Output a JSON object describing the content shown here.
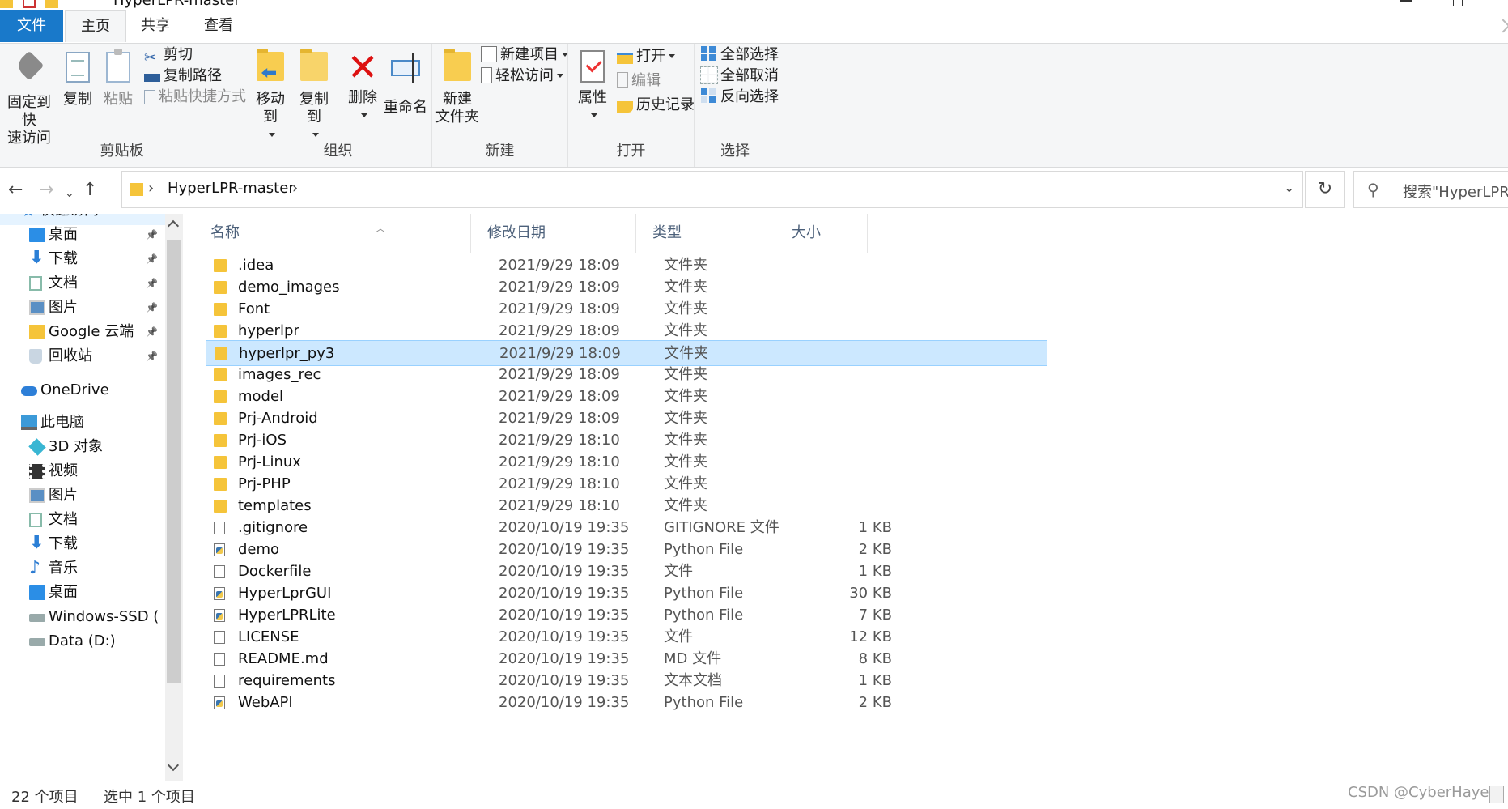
{
  "window": {
    "title": "HyperLPR-master"
  },
  "tabs": {
    "file": "文件",
    "home": "主页",
    "share": "共享",
    "view": "查看"
  },
  "ribbon": {
    "clipboard": {
      "pin": "固定到快速访问",
      "pin_line1": "固定到快",
      "pin_line2": "速访问",
      "copy": "复制",
      "paste": "粘贴",
      "cut": "剪切",
      "copy_path": "复制路径",
      "paste_shortcut": "粘贴快捷方式",
      "label": "剪贴板"
    },
    "organize": {
      "move_to": "移动到",
      "copy_to": "复制到",
      "delete": "删除",
      "rename": "重命名",
      "label": "组织"
    },
    "new": {
      "new_folder_line1": "新建",
      "new_folder_line2": "文件夹",
      "new_item": "新建项目",
      "easy_access": "轻松访问",
      "label": "新建"
    },
    "open": {
      "properties": "属性",
      "open": "打开",
      "edit": "编辑",
      "history": "历史记录",
      "label": "打开"
    },
    "select": {
      "select_all": "全部选择",
      "select_none": "全部取消",
      "invert": "反向选择",
      "label": "选择"
    }
  },
  "address": {
    "path": "HyperLPR-master",
    "search_placeholder": "搜索\"HyperLPR"
  },
  "sidebar": {
    "items": [
      {
        "label": "快速访问",
        "icon": "star-icon",
        "pinned": false
      },
      {
        "label": "桌面",
        "icon": "desktop-icon",
        "pinned": true
      },
      {
        "label": "下载",
        "icon": "download-icon",
        "pinned": true
      },
      {
        "label": "文档",
        "icon": "document-icon",
        "pinned": true
      },
      {
        "label": "图片",
        "icon": "picture-icon",
        "pinned": true
      },
      {
        "label": "Google 云端",
        "icon": "google-drive-folder-icon",
        "pinned": true
      },
      {
        "label": "回收站",
        "icon": "recycle-bin-icon",
        "pinned": true
      },
      {
        "label": "OneDrive",
        "icon": "cloud-icon",
        "pinned": false
      },
      {
        "label": "此电脑",
        "icon": "computer-icon",
        "pinned": false
      },
      {
        "label": "3D 对象",
        "icon": "cube-icon",
        "pinned": false
      },
      {
        "label": "视频",
        "icon": "video-icon",
        "pinned": false
      },
      {
        "label": "图片",
        "icon": "picture-icon",
        "pinned": false
      },
      {
        "label": "文档",
        "icon": "document-icon",
        "pinned": false
      },
      {
        "label": "下载",
        "icon": "download-icon",
        "pinned": false
      },
      {
        "label": "音乐",
        "icon": "music-icon",
        "pinned": false
      },
      {
        "label": "桌面",
        "icon": "desktop-icon",
        "pinned": false
      },
      {
        "label": "Windows-SSD (",
        "icon": "drive-icon",
        "pinned": false
      },
      {
        "label": "Data (D:)",
        "icon": "drive-icon",
        "pinned": false
      }
    ]
  },
  "columns": {
    "name": "名称",
    "date": "修改日期",
    "type": "类型",
    "size": "大小"
  },
  "files": [
    {
      "name": ".idea",
      "date": "2021/9/29 18:09",
      "type": "文件夹",
      "size": "",
      "kind": "folder"
    },
    {
      "name": "demo_images",
      "date": "2021/9/29 18:09",
      "type": "文件夹",
      "size": "",
      "kind": "folder"
    },
    {
      "name": "Font",
      "date": "2021/9/29 18:09",
      "type": "文件夹",
      "size": "",
      "kind": "folder"
    },
    {
      "name": "hyperlpr",
      "date": "2021/9/29 18:09",
      "type": "文件夹",
      "size": "",
      "kind": "folder"
    },
    {
      "name": "hyperlpr_py3",
      "date": "2021/9/29 18:09",
      "type": "文件夹",
      "size": "",
      "kind": "folder",
      "selected": true
    },
    {
      "name": "images_rec",
      "date": "2021/9/29 18:09",
      "type": "文件夹",
      "size": "",
      "kind": "folder"
    },
    {
      "name": "model",
      "date": "2021/9/29 18:09",
      "type": "文件夹",
      "size": "",
      "kind": "folder"
    },
    {
      "name": "Prj-Android",
      "date": "2021/9/29 18:09",
      "type": "文件夹",
      "size": "",
      "kind": "folder"
    },
    {
      "name": "Prj-iOS",
      "date": "2021/9/29 18:10",
      "type": "文件夹",
      "size": "",
      "kind": "folder"
    },
    {
      "name": "Prj-Linux",
      "date": "2021/9/29 18:10",
      "type": "文件夹",
      "size": "",
      "kind": "folder"
    },
    {
      "name": "Prj-PHP",
      "date": "2021/9/29 18:10",
      "type": "文件夹",
      "size": "",
      "kind": "folder"
    },
    {
      "name": "templates",
      "date": "2021/9/29 18:10",
      "type": "文件夹",
      "size": "",
      "kind": "folder"
    },
    {
      "name": ".gitignore",
      "date": "2020/10/19 19:35",
      "type": "GITIGNORE 文件",
      "size": "1 KB",
      "kind": "file"
    },
    {
      "name": "demo",
      "date": "2020/10/19 19:35",
      "type": "Python File",
      "size": "2 KB",
      "kind": "py"
    },
    {
      "name": "Dockerfile",
      "date": "2020/10/19 19:35",
      "type": "文件",
      "size": "1 KB",
      "kind": "file"
    },
    {
      "name": "HyperLprGUI",
      "date": "2020/10/19 19:35",
      "type": "Python File",
      "size": "30 KB",
      "kind": "py"
    },
    {
      "name": "HyperLPRLite",
      "date": "2020/10/19 19:35",
      "type": "Python File",
      "size": "7 KB",
      "kind": "py"
    },
    {
      "name": "LICENSE",
      "date": "2020/10/19 19:35",
      "type": "文件",
      "size": "12 KB",
      "kind": "file"
    },
    {
      "name": "README.md",
      "date": "2020/10/19 19:35",
      "type": "MD 文件",
      "size": "8 KB",
      "kind": "file"
    },
    {
      "name": "requirements",
      "date": "2020/10/19 19:35",
      "type": "文本文档",
      "size": "1 KB",
      "kind": "txt"
    },
    {
      "name": "WebAPI",
      "date": "2020/10/19 19:35",
      "type": "Python File",
      "size": "2 KB",
      "kind": "py"
    }
  ],
  "status": {
    "count": "22 个项目",
    "selected": "选中 1 个项目"
  },
  "watermark": "CSDN @CyberHaye",
  "colors": {
    "accent": "#1979ca",
    "selection": "#cce8ff",
    "selection_border": "#99d1ff",
    "folder": "#f5c43a"
  }
}
